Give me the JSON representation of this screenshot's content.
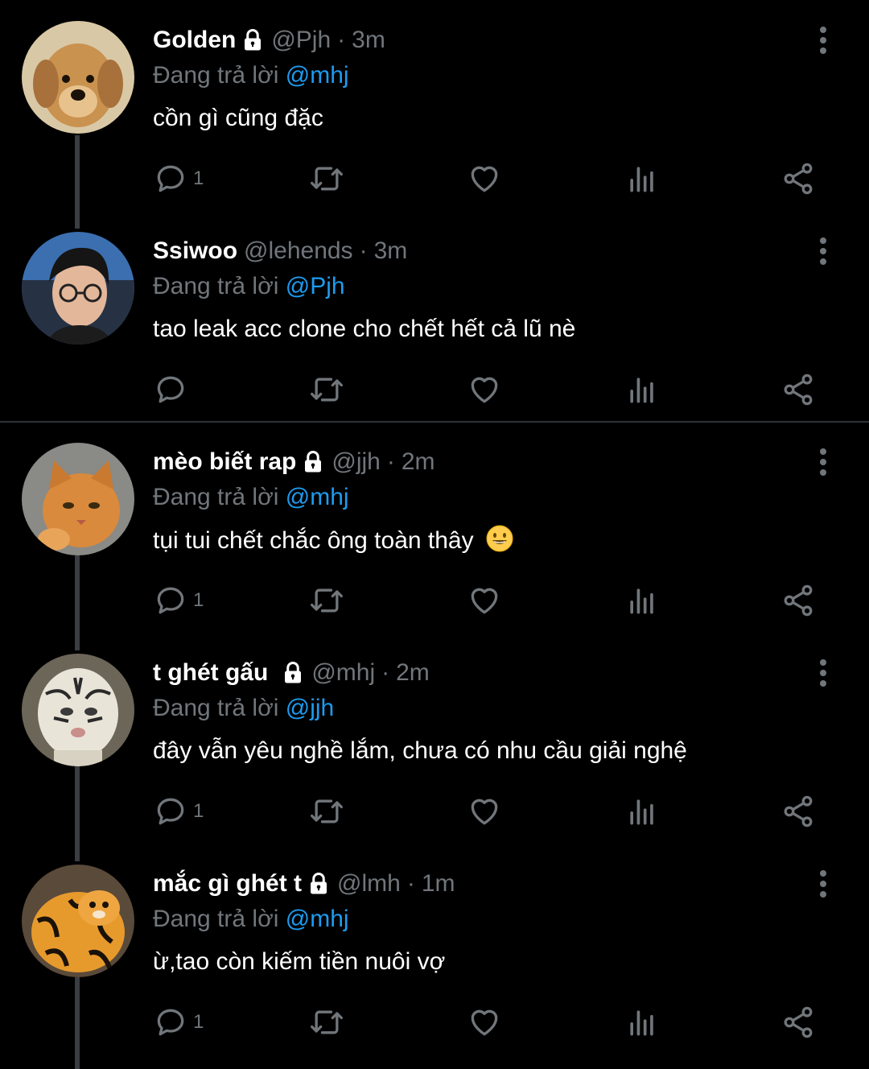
{
  "replying_prefix": "Đang trả lời",
  "colors": {
    "background": "#000000",
    "name": "#ffffff",
    "muted": "#71767b",
    "mention": "#1d9bf0",
    "thread_line": "#3a3d41"
  },
  "icons": {
    "reply": "reply-icon",
    "retweet": "retweet-icon",
    "like": "heart-icon",
    "views": "views-icon",
    "share": "share-icon",
    "more": "more-icon",
    "lock": "lock-icon"
  },
  "tweets": [
    {
      "avatar": "golden-retriever-puppy",
      "name": "Golden",
      "locked": true,
      "handle": "@Pjh",
      "separator": "·",
      "time": "3m",
      "replying_to": "@mhj",
      "text": "cồn gì cũng đặc",
      "reply_count": "1"
    },
    {
      "avatar": "person-with-glasses",
      "name": "Ssiwoo",
      "locked": false,
      "handle": "@lehends",
      "separator": "·",
      "time": "3m",
      "replying_to": "@Pjh",
      "text": "tao leak acc clone cho chết hết cả lũ nè",
      "reply_count": ""
    },
    {
      "avatar": "orange-cat",
      "name": "mèo biết rap",
      "locked": true,
      "handle": "@jjh",
      "separator": "·",
      "time": "2m",
      "replying_to": "@mhj",
      "text": "tụi tui chết chắc ông toàn thây",
      "reply_count": "1"
    },
    {
      "avatar": "white-tiger-figure",
      "name": "t ghét gấu",
      "locked": true,
      "handle": "@mhj",
      "separator": "·",
      "time": "2m",
      "replying_to": "@jjh",
      "text": "đây vẫn yêu nghề lắm, chưa có nhu cầu giải nghệ",
      "reply_count": "1"
    },
    {
      "avatar": "orange-tiger-figure",
      "name": "mắc gì ghét t",
      "locked": true,
      "handle": "@lmh",
      "separator": "·",
      "time": "1m",
      "replying_to": "@mhj",
      "text": "ừ,tao còn kiếm tiền nuôi vợ",
      "reply_count": "1"
    }
  ]
}
